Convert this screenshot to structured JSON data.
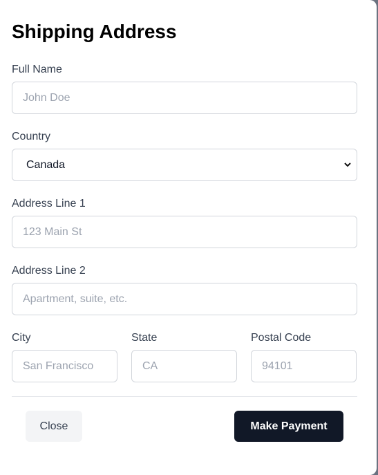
{
  "title": "Shipping Address",
  "fields": {
    "full_name": {
      "label": "Full Name",
      "placeholder": "John Doe",
      "value": ""
    },
    "country": {
      "label": "Country",
      "value": "Canada"
    },
    "address1": {
      "label": "Address Line 1",
      "placeholder": "123 Main St",
      "value": ""
    },
    "address2": {
      "label": "Address Line 2",
      "placeholder": "Apartment, suite, etc.",
      "value": ""
    },
    "city": {
      "label": "City",
      "placeholder": "San Francisco",
      "value": ""
    },
    "state": {
      "label": "State",
      "placeholder": "CA",
      "value": ""
    },
    "postal": {
      "label": "Postal Code",
      "placeholder": "94101",
      "value": ""
    }
  },
  "buttons": {
    "close": "Close",
    "pay": "Make Payment"
  }
}
